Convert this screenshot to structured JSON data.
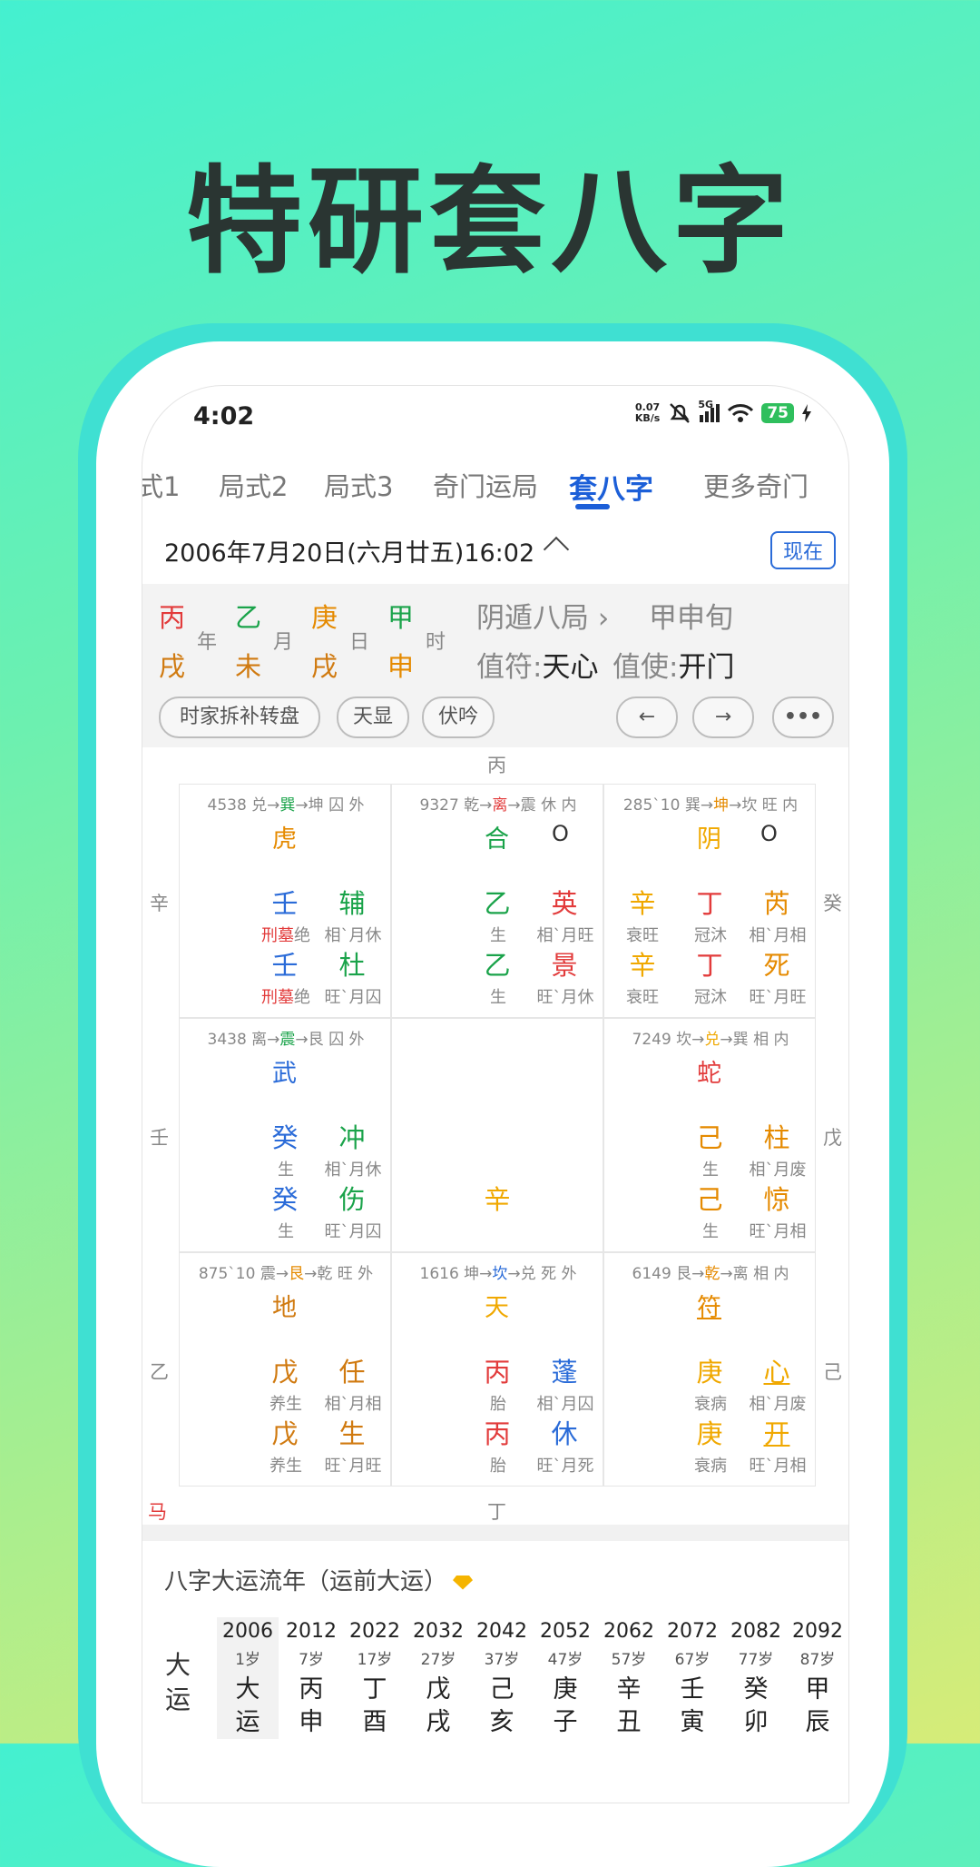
{
  "hero_title": "特研套八字",
  "status_bar": {
    "time": "4:02",
    "net_speed_value": "0.07",
    "net_speed_unit": "KB/s",
    "signal_label": "5G",
    "battery": "75"
  },
  "tabs": [
    "式1",
    "局式2",
    "局式3",
    "奇门运局",
    "套八字",
    "更多奇门"
  ],
  "active_tab": "套八字",
  "date_text": "2006年7月20日(六月廿五)16:02",
  "now_button": "现在",
  "pillars": [
    {
      "stem": "丙",
      "branch": "戌",
      "label": "年"
    },
    {
      "stem": "乙",
      "branch": "未",
      "label": "月"
    },
    {
      "stem": "庚",
      "branch": "戌",
      "label": "日"
    },
    {
      "stem": "甲",
      "branch": "申",
      "label": "时"
    }
  ],
  "ju": "阴遁八局",
  "xun": "甲申旬",
  "zhifu_label": "值符:",
  "zhifu_value": "天心",
  "zhishi_label": "值使:",
  "zhishi_value": "开门",
  "pills": [
    "时家拆补转盘",
    "天显",
    "伏吟"
  ],
  "nav": {
    "prev": "←",
    "next": "→",
    "more": "•••"
  },
  "outer_labels": {
    "top": "丙",
    "bottom": "丁",
    "left": [
      "辛",
      "壬",
      "乙"
    ],
    "right": [
      "癸",
      "戊",
      "己"
    ],
    "corner": "马"
  },
  "palaces": [
    {
      "header": [
        "4538 兑→",
        "巽",
        "→坤 囚 外"
      ],
      "god": "虎",
      "circle": "",
      "r1": [
        "壬",
        "辅"
      ],
      "r1s": [
        "刑墓",
        "绝",
        "相`月休"
      ],
      "r2": [
        "壬",
        "杜"
      ],
      "r2s": [
        "刑墓",
        "绝",
        "旺`月囚"
      ]
    },
    {
      "header": [
        "9327 乾→",
        "离",
        "→震 休 内"
      ],
      "god": "合",
      "circle": "O",
      "r1": [
        "乙",
        "英"
      ],
      "r1s": [
        "",
        "生",
        "相`月旺"
      ],
      "r2": [
        "乙",
        "景"
      ],
      "r2s": [
        "",
        "生",
        "旺`月休"
      ]
    },
    {
      "header": [
        "285`10 巽→",
        "坤",
        "→坎 旺 内"
      ],
      "god": "阴",
      "circle": "O",
      "r1": [
        "辛",
        "丁",
        "芮"
      ],
      "r1s": [
        "衰旺",
        "冠沐",
        "相`月相"
      ],
      "r2": [
        "辛",
        "丁",
        "死"
      ],
      "r2s": [
        "衰旺",
        "冠沐",
        "旺`月旺"
      ]
    },
    {
      "header": [
        "3438 离→",
        "震",
        "→艮 囚 外"
      ],
      "god": "武",
      "circle": "",
      "r1": [
        "癸",
        "冲"
      ],
      "r1s": [
        "",
        "生",
        "相`月休"
      ],
      "r2": [
        "癸",
        "伤"
      ],
      "r2s": [
        "",
        "生",
        "旺`月囚"
      ]
    },
    {
      "center": "辛"
    },
    {
      "header": [
        "7249 坎→",
        "兑",
        "→巽 相 内"
      ],
      "god": "蛇",
      "circle": "",
      "r1": [
        "己",
        "柱"
      ],
      "r1s": [
        "",
        "生",
        "相`月废"
      ],
      "r2": [
        "己",
        "惊"
      ],
      "r2s": [
        "",
        "生",
        "旺`月相"
      ]
    },
    {
      "header": [
        "875`10 震→",
        "艮",
        "→乾 旺 外"
      ],
      "god": "地",
      "circle": "",
      "r1": [
        "戊",
        "任"
      ],
      "r1s": [
        "",
        "养生",
        "相`月相"
      ],
      "r2": [
        "戊",
        "生"
      ],
      "r2s": [
        "",
        "养生",
        "旺`月旺"
      ]
    },
    {
      "header": [
        "1616 坤→",
        "坎",
        "→兑 死 外"
      ],
      "god": "天",
      "circle": "",
      "r1": [
        "丙",
        "蓬"
      ],
      "r1s": [
        "",
        "胎",
        "相`月囚"
      ],
      "r2": [
        "丙",
        "休"
      ],
      "r2s": [
        "",
        "胎",
        "旺`月死"
      ]
    },
    {
      "header": [
        "6149 艮→",
        "乾",
        "→离 相 内"
      ],
      "god": "符",
      "circle": "",
      "r1": [
        "庚",
        "心"
      ],
      "r1s": [
        "",
        "衰病",
        "相`月废"
      ],
      "r2": [
        "庚",
        "开"
      ],
      "r2s": [
        "",
        "衰病",
        "旺`月相"
      ]
    }
  ],
  "colors": {
    "red": "#e23b3b",
    "green": "#1aa34a",
    "orange": "#e58a00",
    "blue": "#2a6bd8",
    "yellow": "#f0a800",
    "brown": "#d07a10",
    "accent": "#1c5fd8"
  },
  "dayun": {
    "title": "八字大运流年（运前大运）",
    "row_label": "大运",
    "columns": [
      {
        "year": "2006",
        "age": "1岁",
        "gz": "大运"
      },
      {
        "year": "2012",
        "age": "7岁",
        "gz": "丙申"
      },
      {
        "year": "2022",
        "age": "17岁",
        "gz": "丁酉"
      },
      {
        "year": "2032",
        "age": "27岁",
        "gz": "戊戌"
      },
      {
        "year": "2042",
        "age": "37岁",
        "gz": "己亥"
      },
      {
        "year": "2052",
        "age": "47岁",
        "gz": "庚子"
      },
      {
        "year": "2062",
        "age": "57岁",
        "gz": "辛丑"
      },
      {
        "year": "2072",
        "age": "67岁",
        "gz": "壬寅"
      },
      {
        "year": "2082",
        "age": "77岁",
        "gz": "癸卯"
      },
      {
        "year": "2092",
        "age": "87岁",
        "gz": "甲辰"
      }
    ]
  }
}
